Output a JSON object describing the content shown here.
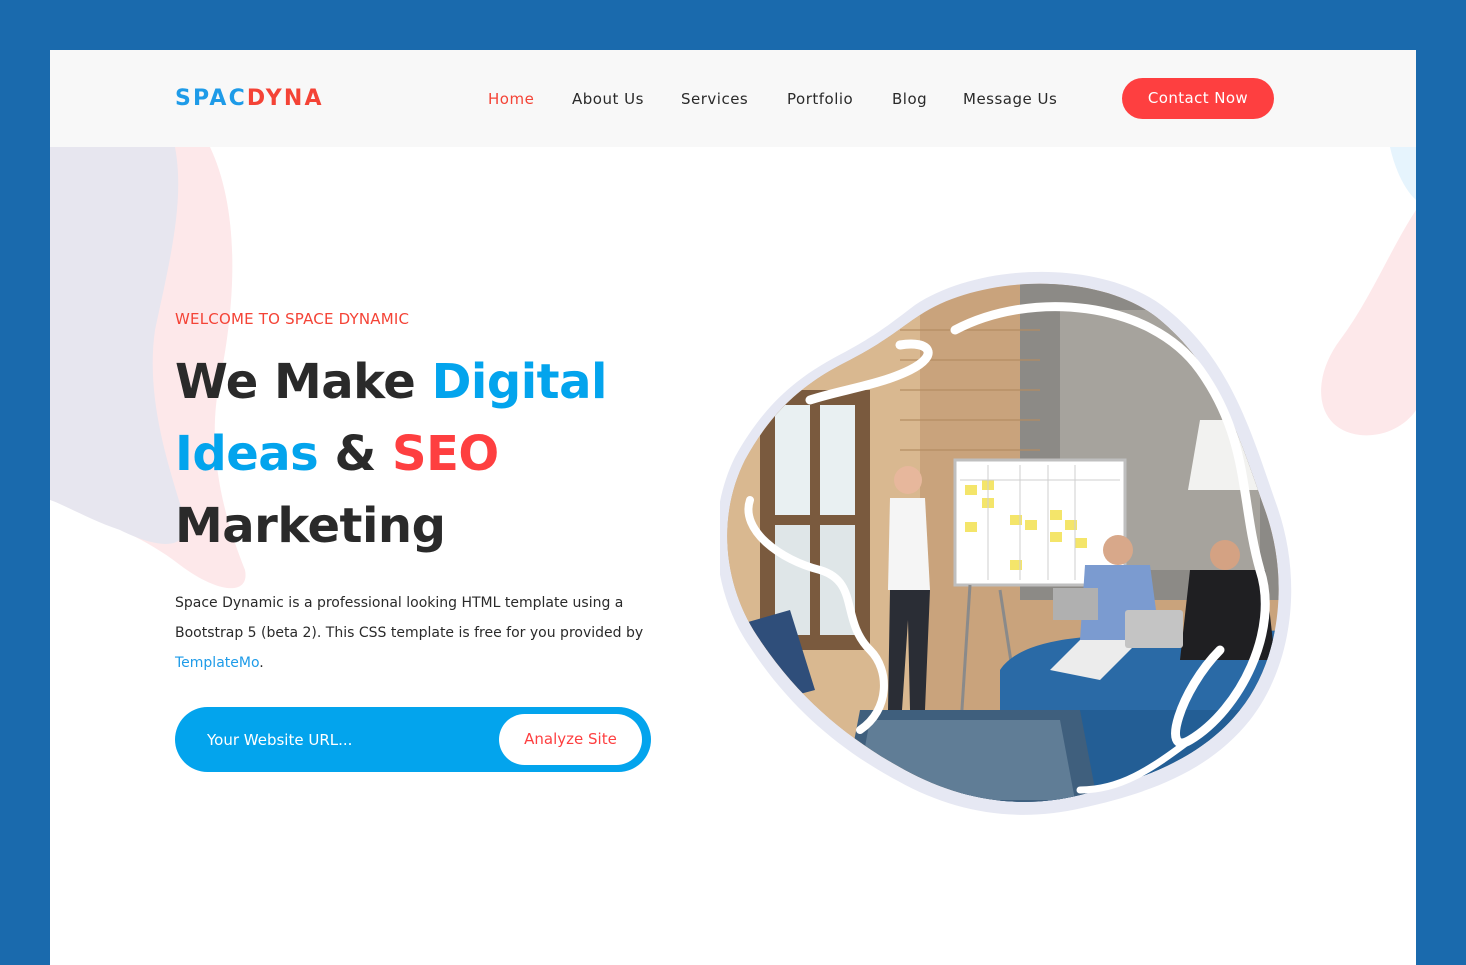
{
  "brand": {
    "logo_part1": "SPAC",
    "logo_part2": "DYNA"
  },
  "nav": {
    "items": [
      {
        "label": "Home",
        "active": true
      },
      {
        "label": "About Us",
        "active": false
      },
      {
        "label": "Services",
        "active": false
      },
      {
        "label": "Portfolio",
        "active": false
      },
      {
        "label": "Blog",
        "active": false
      },
      {
        "label": "Message Us",
        "active": false
      }
    ],
    "cta_label": "Contact Now"
  },
  "hero": {
    "eyebrow": "WELCOME TO SPACE DYNAMIC",
    "headline": {
      "part1": "We Make ",
      "part2": "Digital",
      "part3": "Ideas",
      "part4": " & ",
      "part5": "SEO",
      "part6": "Marketing"
    },
    "description": "Space Dynamic is a professional looking HTML template using a Bootstrap 5 (beta 2). This CSS template is free for you provided by ",
    "description_link": "TemplateMo",
    "description_end": ".",
    "search": {
      "placeholder": "Your Website URL...",
      "button_label": "Analyze Site"
    }
  },
  "colors": {
    "page_bg": "#1a6aad",
    "accent_blue": "#03a4ed",
    "accent_red": "#fe3f40",
    "text_dark": "#2a2a2a",
    "header_bg": "#f8f8f8"
  },
  "icons": {
    "hero_image": "team-meeting-photo"
  }
}
